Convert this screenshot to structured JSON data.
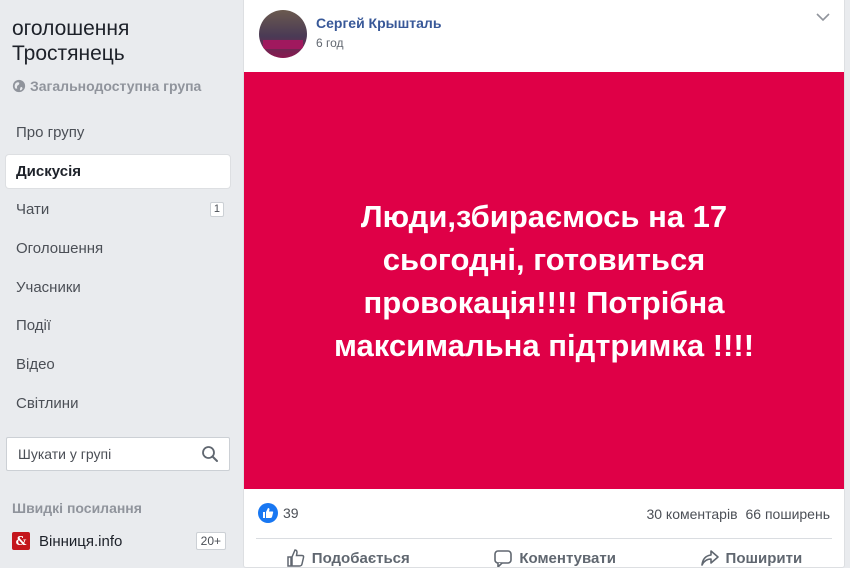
{
  "group": {
    "title_line1": "оголошення",
    "title_line2": "Тростянець",
    "type": "Загальнодоступна група"
  },
  "nav": [
    {
      "label": "Про групу",
      "active": false
    },
    {
      "label": "Дискусія",
      "active": true
    },
    {
      "label": "Чати",
      "active": false,
      "badge": "1"
    },
    {
      "label": "Оголошення",
      "active": false
    },
    {
      "label": "Учасники",
      "active": false
    },
    {
      "label": "Події",
      "active": false
    },
    {
      "label": "Відео",
      "active": false
    },
    {
      "label": "Світлини",
      "active": false
    }
  ],
  "search": {
    "placeholder": "Шукати у групі"
  },
  "quick_links": {
    "title": "Швидкі посилання",
    "items": [
      {
        "label": "Вінниця.info",
        "badge": "20+",
        "icon": "vinnytsia-info-logo"
      }
    ]
  },
  "post": {
    "author": "Сергей Крышталь",
    "time": "6 год",
    "banner_color": "#df0047",
    "banner_lines": [
      "Люди,збираємось на 17",
      "сьогодні, готовиться",
      "провокація!!!! Потрібна",
      "максимальна підтримка !!!!"
    ],
    "reactions_count": "39",
    "comments": "30 коментарів",
    "shares": "66 поширень",
    "actions": {
      "like": "Подобається",
      "comment": "Коментувати",
      "share": "Поширити"
    }
  },
  "colors": {
    "link_blue": "#385898",
    "like_blue": "#1877f2",
    "page_bg": "#e9ebee"
  }
}
